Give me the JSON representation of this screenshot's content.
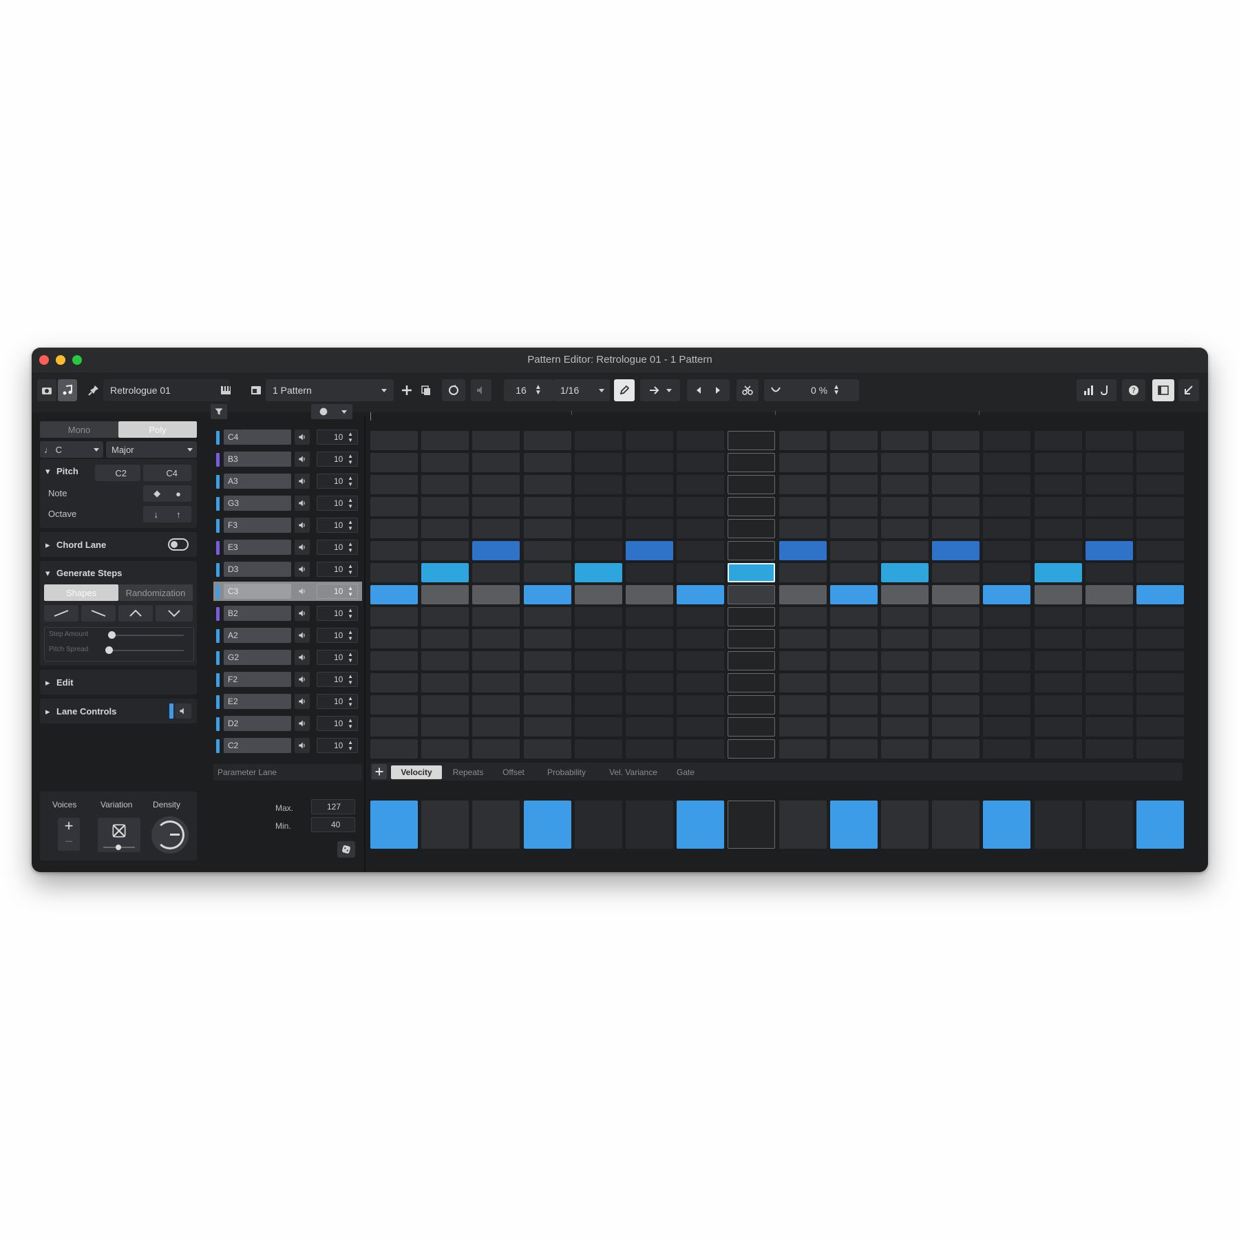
{
  "window": {
    "title": "Pattern Editor: Retrologue 01 - 1 Pattern",
    "traffic_lights": [
      "#ff5f57",
      "#febc2e",
      "#28c840"
    ]
  },
  "toolbar": {
    "instrument": "Retrologue 01",
    "pattern": "1 Pattern",
    "steps": "16",
    "resolution": "1/16",
    "swing": "0 %"
  },
  "left_panel": {
    "mode_tabs": [
      "Mono",
      "Poly"
    ],
    "root": "C",
    "scale": "Major",
    "pitch": {
      "label": "Pitch",
      "low": "C2",
      "high": "C4"
    },
    "note_label": "Note",
    "octave_label": "Octave",
    "chord_lane": "Chord Lane",
    "generate_steps": "Generate Steps",
    "gen_tabs": [
      "Shapes",
      "Randomization"
    ],
    "slider1": "Step Amount",
    "slider2": "Pitch Spread",
    "edit": "Edit",
    "lane_controls": "Lane Controls",
    "bottom_labels": [
      "Voices",
      "Variation",
      "Density"
    ]
  },
  "lanes": [
    {
      "name": "C4",
      "color": "#3aa0e8",
      "vel": "10"
    },
    {
      "name": "B3",
      "color": "#7a5ce0",
      "vel": "10"
    },
    {
      "name": "A3",
      "color": "#3aa0e8",
      "vel": "10"
    },
    {
      "name": "G3",
      "color": "#3aa0e8",
      "vel": "10"
    },
    {
      "name": "F3",
      "color": "#3aa0e8",
      "vel": "10"
    },
    {
      "name": "E3",
      "color": "#7a5ce0",
      "vel": "10"
    },
    {
      "name": "D3",
      "color": "#3aa0e8",
      "vel": "10"
    },
    {
      "name": "C3",
      "color": "#3aa0e8",
      "vel": "10"
    },
    {
      "name": "B2",
      "color": "#7a5ce0",
      "vel": "10"
    },
    {
      "name": "A2",
      "color": "#3aa0e8",
      "vel": "10"
    },
    {
      "name": "G2",
      "color": "#3aa0e8",
      "vel": "10"
    },
    {
      "name": "F2",
      "color": "#3aa0e8",
      "vel": "10"
    },
    {
      "name": "E2",
      "color": "#3aa0e8",
      "vel": "10"
    },
    {
      "name": "D2",
      "color": "#3aa0e8",
      "vel": "10"
    },
    {
      "name": "C2",
      "color": "#3aa0e8",
      "vel": "10"
    }
  ],
  "selected_lane": 7,
  "grid": {
    "steps": 16,
    "cursor_step": 7,
    "notes": [
      {
        "row": 5,
        "steps": [
          2,
          5,
          8,
          11,
          14
        ],
        "color": "#2f72c9"
      },
      {
        "row": 6,
        "steps": [
          1,
          4,
          7,
          10,
          13
        ],
        "color": "#2ea6dd"
      },
      {
        "row": 7,
        "steps": [
          0,
          3,
          6,
          9,
          12,
          15
        ],
        "color": "#3d9ce8"
      }
    ]
  },
  "parameter_lane": {
    "label": "Parameter Lane",
    "tabs": [
      "Velocity",
      "Repeats",
      "Offset",
      "Probability",
      "Vel. Variance",
      "Gate"
    ],
    "max_label": "Max.",
    "max": "127",
    "min_label": "Min.",
    "min": "40",
    "velocity_steps": [
      0,
      3,
      6,
      9,
      12,
      15
    ]
  }
}
